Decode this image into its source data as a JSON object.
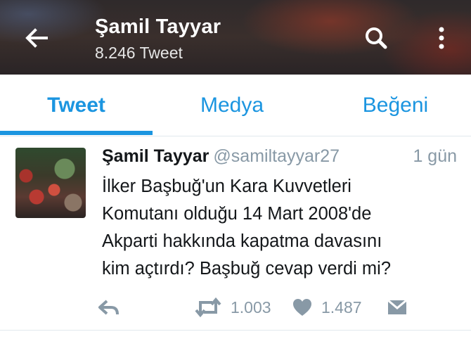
{
  "header": {
    "title": "Şamil Tayyar",
    "subtitle": "8.246 Tweet",
    "icons": {
      "back": "arrow-left-icon",
      "search": "search-icon",
      "more": "more-vertical-icon"
    }
  },
  "tabs": [
    {
      "label": "Tweet",
      "active": true
    },
    {
      "label": "Medya",
      "active": false
    },
    {
      "label": "Beğeni",
      "active": false
    }
  ],
  "colors": {
    "accent": "#1b95e0",
    "muted": "#8899a6",
    "text": "#14171a"
  },
  "tweet": {
    "name": "Şamil Tayyar",
    "handle": "@samiltayyar27",
    "time": "1 gün",
    "lines": [
      "İlker Başbuğ'un Kara Kuvvetleri",
      "Komutanı olduğu 14 Mart 2008'de",
      "Akparti hakkında kapatma davasını",
      "kim açtırdı? Başbuğ cevap verdi mi?"
    ],
    "retweet_count": "1.003",
    "like_count": "1.487",
    "icons": {
      "reply": "reply-icon",
      "retweet": "retweet-icon",
      "like": "heart-icon",
      "dm": "envelope-icon"
    }
  }
}
